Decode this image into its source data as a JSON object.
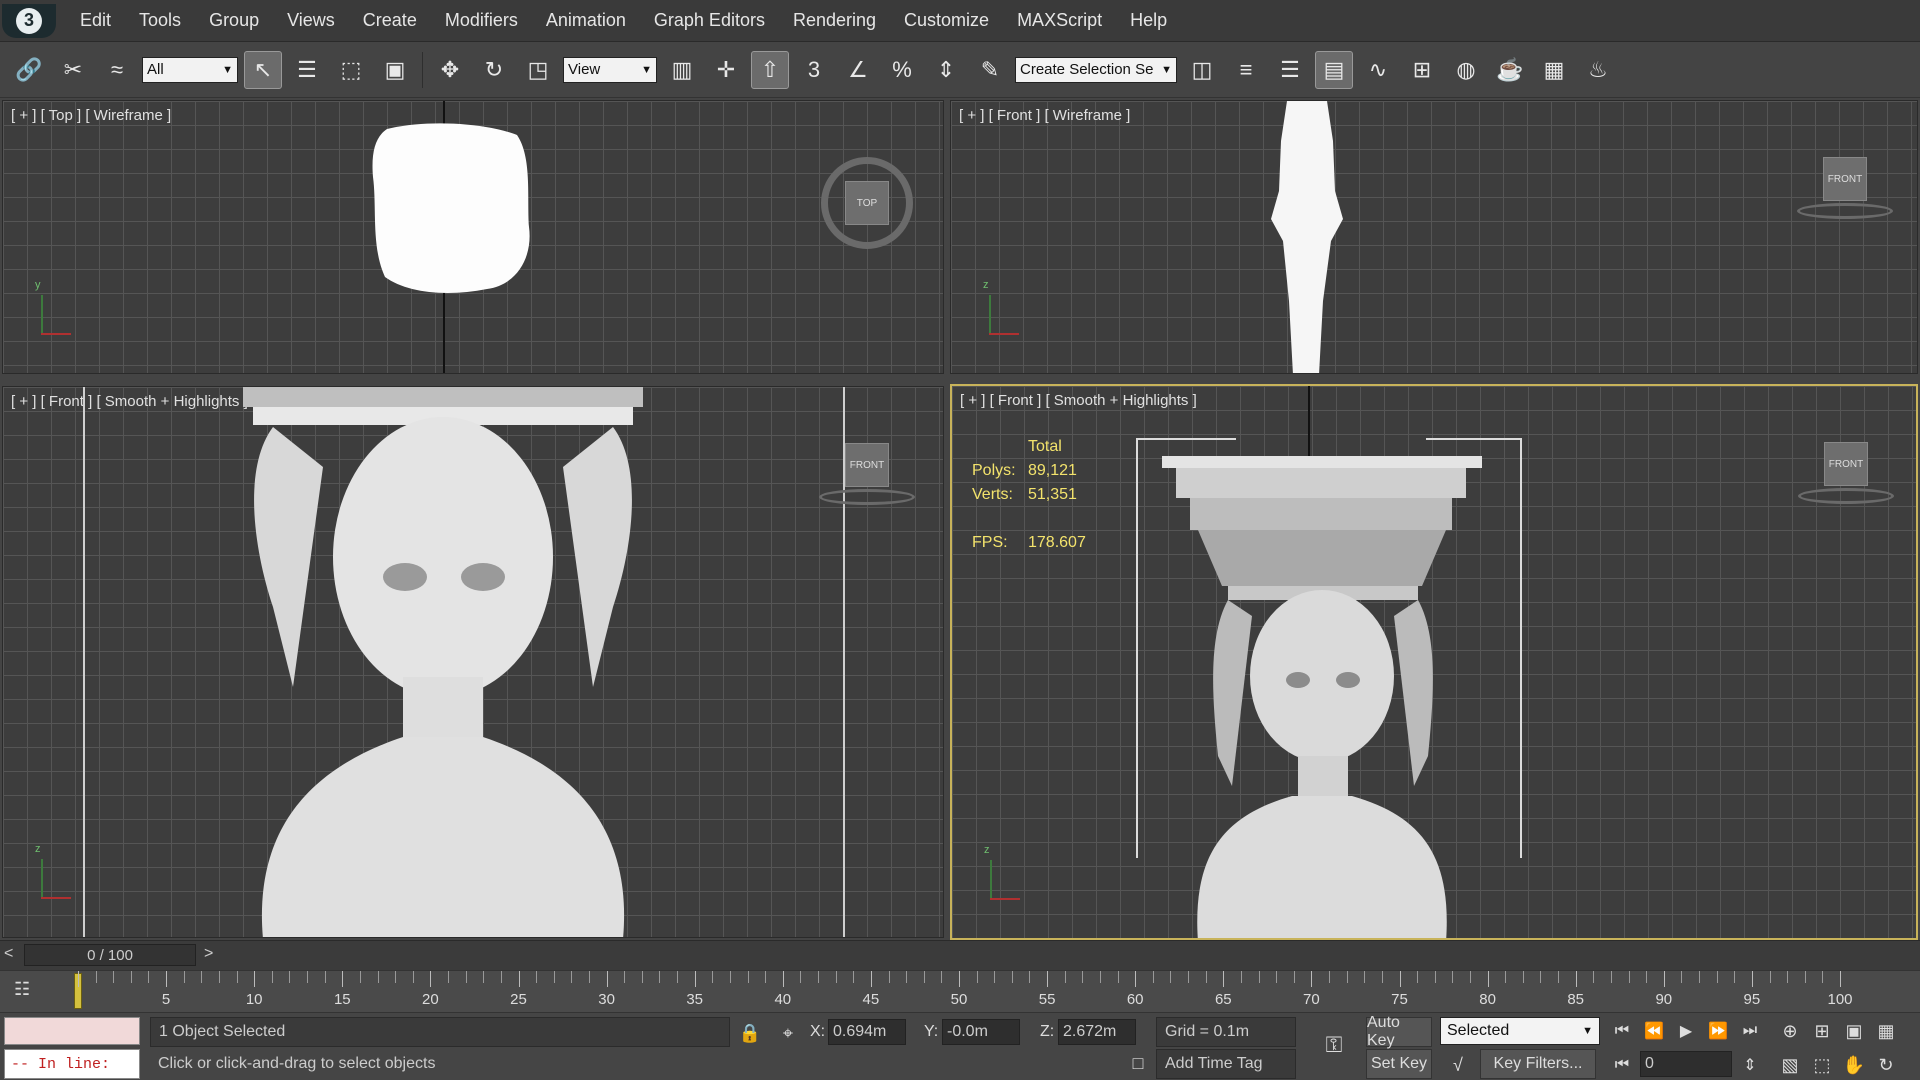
{
  "menu": {
    "items": [
      "Edit",
      "Tools",
      "Group",
      "Views",
      "Create",
      "Modifiers",
      "Animation",
      "Graph Editors",
      "Rendering",
      "Customize",
      "MAXScript",
      "Help"
    ]
  },
  "toolbar": {
    "filter_select": "All",
    "coord_select": "View",
    "selection_set": "Create Selection Se",
    "snap_angle_label": "3",
    "percent_label": "%"
  },
  "viewports": {
    "top_left": {
      "label": "[ + ] [ Top ] [ Wireframe ]",
      "cube": "TOP",
      "axis": "y"
    },
    "top_right": {
      "label": "[ + ] [ Front ] [ Wireframe ]",
      "cube": "FRONT",
      "axis": "z"
    },
    "bottom_left": {
      "label": "[ + ] [ Front ] [ Smooth + Highlights ]",
      "cube": "FRONT",
      "axis": "z"
    },
    "bottom_right": {
      "label": "[ + ] [ Front ] [ Smooth + Highlights ]",
      "cube": "FRONT",
      "axis": "z",
      "stats": {
        "header": "Total",
        "polys_label": "Polys:",
        "polys": "89,121",
        "verts_label": "Verts:",
        "verts": "51,351",
        "fps_label": "FPS:",
        "fps": "178.607"
      }
    }
  },
  "timeslider": {
    "left": "<",
    "frame": "0 / 100",
    "right": ">"
  },
  "trackbar": {
    "tick_labels": [
      "5",
      "10",
      "15",
      "20",
      "25",
      "30",
      "35",
      "40",
      "45",
      "50",
      "55",
      "60",
      "65",
      "70",
      "75",
      "80",
      "85",
      "90",
      "95",
      "100"
    ]
  },
  "status": {
    "listener_prompt": "-- In line:",
    "selection_info": "1 Object Selected",
    "prompt": "Click or click-and-drag to select objects",
    "x_label": "X:",
    "x_value": "0.694m",
    "y_label": "Y:",
    "y_value": "-0.0m",
    "z_label": "Z:",
    "z_value": "2.672m",
    "grid": "Grid = 0.1m",
    "add_time_tag": "Add Time Tag",
    "auto_key": "Auto Key",
    "set_key": "Set Key",
    "key_mode": "Selected",
    "key_filters": "Key Filters...",
    "frame_field": "0"
  },
  "colors": {
    "active_border": "#c8b35a",
    "stats_text": "#f3e36c",
    "listener_text": "#c02020"
  }
}
